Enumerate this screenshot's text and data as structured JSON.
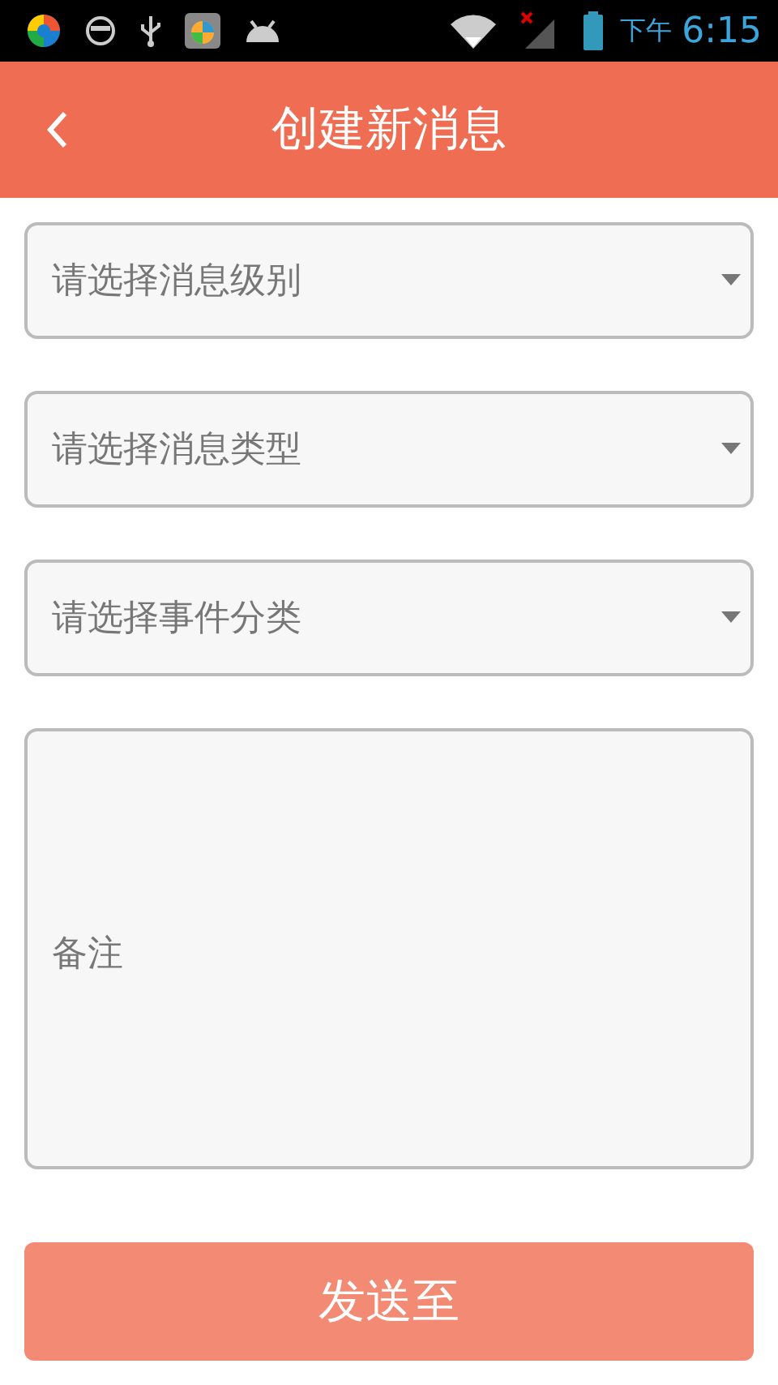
{
  "status_bar": {
    "ampm": "下午",
    "time": "6:15"
  },
  "app_bar": {
    "title": "创建新消息"
  },
  "selects": [
    {
      "placeholder": "请选择消息级别"
    },
    {
      "placeholder": "请选择消息类型"
    },
    {
      "placeholder": "请选择事件分类"
    }
  ],
  "note": {
    "placeholder": "备注"
  },
  "send_button": {
    "label": "发送至"
  }
}
